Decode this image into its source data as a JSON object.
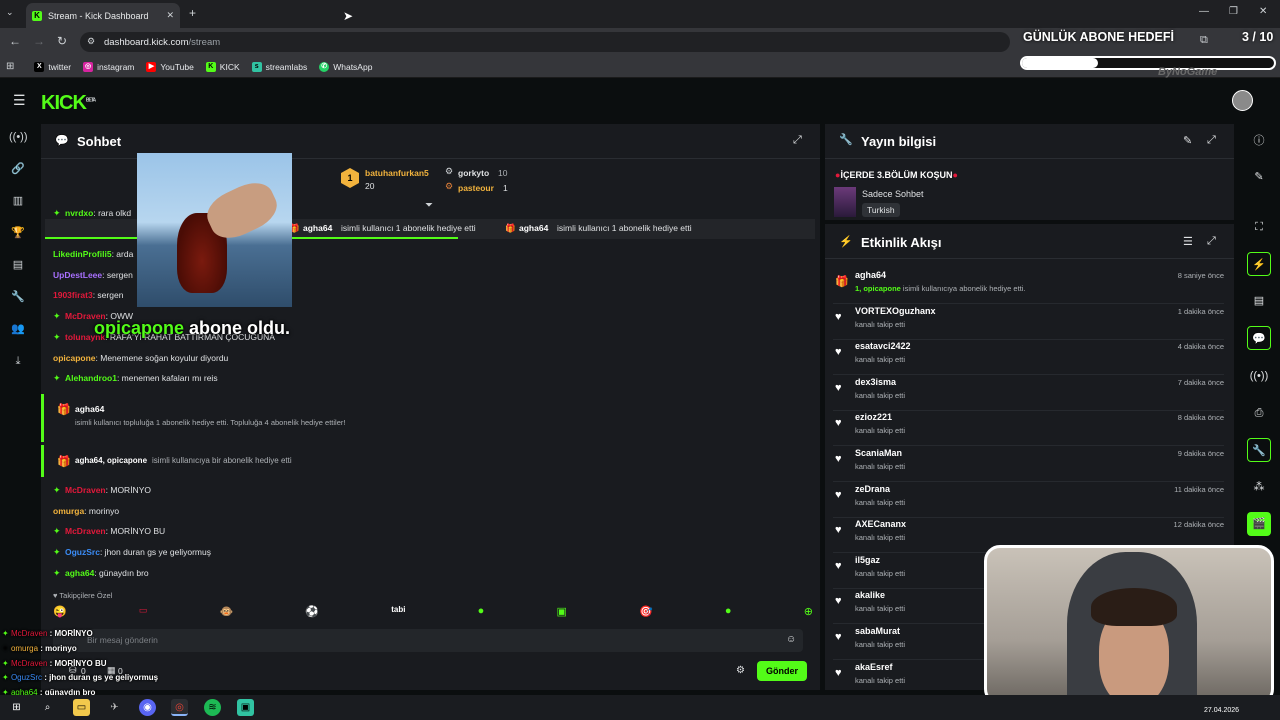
{
  "browser": {
    "tab_title": "Stream - Kick Dashboard",
    "tab_favicon": "kick-logo-icon",
    "new_tab_icon": "+",
    "url_domain": "dashboard.kick.com",
    "url_path": "/stream",
    "bookmarks": [
      {
        "label": "twitter",
        "icon": "x-logo-icon",
        "color": "#000000"
      },
      {
        "label": "instagram",
        "icon": "instagram-icon",
        "color": "#d6249f"
      },
      {
        "label": "YouTube",
        "icon": "youtube-icon",
        "color": "#ff0000"
      },
      {
        "label": "KICK",
        "icon": "kick-logo-icon",
        "color": "#53fc18"
      },
      {
        "label": "streamlabs",
        "icon": "streamlabs-icon",
        "color": "#31c3a2"
      },
      {
        "label": "WhatsApp",
        "icon": "whatsapp-icon",
        "color": "#25d366"
      }
    ]
  },
  "overlay": {
    "goal_title": "GÜNLÜK ABONE HEDEFİ",
    "goal_count": "3 / 10",
    "goal_progress": 0.3,
    "brand": "ByNoGame",
    "sub_alert": "opicapone abone oldu.",
    "sub_alert_user": "opicapone"
  },
  "colors": {
    "accent": "#53fc18",
    "panel": "#191b1f",
    "bg": "#0b0e0f",
    "red_user": "#e3193b",
    "purple_user": "#a970ff",
    "gold_user": "#f2b33d",
    "blue_user": "#3b8cf6",
    "green_user": "#53fc18"
  },
  "chat": {
    "title": "Sohbet",
    "pinned_ticker": "isimli kullanıcı 1 abonelik hediye etti",
    "ticker_user": "agha64",
    "leaderboard": [
      {
        "rank": "1",
        "name": "batuhanfurkan5",
        "count": "20"
      },
      {
        "name": "gorkyto",
        "count": "10"
      },
      {
        "name": "pasteour",
        "count": "1"
      }
    ],
    "messages": [
      {
        "user": "nvrdxo",
        "text": ": rara olkd",
        "color": "#53fc18",
        "badge": true
      },
      {
        "user": "LikedinProfili5",
        "text": ": arda",
        "color": "#53fc18"
      },
      {
        "user": "UpDestLeee",
        "text": ": sergen",
        "color": "#a970ff"
      },
      {
        "user": "1903firat3",
        "text": ": sergen",
        "color": "#e3193b"
      },
      {
        "user": "McDraven",
        "text": ": OWW",
        "color": "#e3193b",
        "badge": true
      },
      {
        "user": "tolunaynk",
        "text": ": RAFA'YI RAHAT BATTIRMAN ÇOCUĞUNA",
        "color": "#e3193b",
        "badge": true
      },
      {
        "user": "opicapone",
        "text": ": Menemene soğan koyulur diyordu",
        "color": "#f2b33d"
      },
      {
        "user": "Alehandroo1",
        "text": ": menemen kafaları mı reis",
        "color": "#53fc18",
        "badge": true
      }
    ],
    "gift1_user": "agha64",
    "gift1_text": "isimli kullanıcı topluluğa 1 abonelik hediye etti. Topluluğa 4 abonelik hediye ettiler!",
    "gift2_user": "agha64, opicapone",
    "gift2_text": " isimli kullanıcıya bir abonelik hediye etti",
    "messages2": [
      {
        "user": "McDraven",
        "text": ": MORİNYO",
        "color": "#e3193b",
        "badge": true
      },
      {
        "user": "omurga",
        "text": ": morinyo",
        "color": "#f2b33d"
      },
      {
        "user": "McDraven",
        "text": ": MORİNYO BU",
        "color": "#e3193b",
        "badge": true
      },
      {
        "user": "OguzSrc",
        "text": ": jhon duran gs ye geliyormuş",
        "color": "#3b8cf6",
        "badge": true
      },
      {
        "user": "agha64",
        "text": ": günaydın bro",
        "color": "#53fc18",
        "badge": true
      }
    ],
    "followers_only": "Takipçilere Özel",
    "input_placeholder": "Bir mesaj gönderin",
    "send_label": "Gönder",
    "counter_a": "0",
    "counter_b": "0"
  },
  "overlay_chat": [
    {
      "user": "McDraven",
      "text": " : MORİNYO",
      "color": "#e3193b"
    },
    {
      "user": "omurga",
      "text": " : morinyo",
      "color": "#f2b33d"
    },
    {
      "user": "McDraven",
      "text": " : MORİNYO BU",
      "color": "#e3193b"
    },
    {
      "user": "OguzSrc",
      "text": " : jhon duran gs ye geliyormuş",
      "color": "#3b8cf6"
    },
    {
      "user": "agha64",
      "text": " : günaydın bro",
      "color": "#53fc18"
    }
  ],
  "stream_info": {
    "title": "Yayın bilgisi",
    "stream_title": "İÇERDE 3.BÖLÜM KOŞUN",
    "category": "Sadece Sohbet",
    "language": "Turkish"
  },
  "feed": {
    "title": "Etkinlik Akışı",
    "items": [
      {
        "name": "agha64",
        "sub_user": "1, opicapone",
        "sub": " isimli kullanıcıya abonelik hediye etti.",
        "time": "8 saniye önce",
        "icon": "gift-icon"
      },
      {
        "name": "VORTEXOguzhanx",
        "sub": "kanalı takip etti",
        "time": "1 dakika önce",
        "icon": "heart-icon"
      },
      {
        "name": "esatavci2422",
        "sub": "kanalı takip etti",
        "time": "4 dakika önce",
        "icon": "heart-icon"
      },
      {
        "name": "dex3isma",
        "sub": "kanalı takip etti",
        "time": "7 dakika önce",
        "icon": "heart-icon"
      },
      {
        "name": "ezioz221",
        "sub": "kanalı takip etti",
        "time": "8 dakika önce",
        "icon": "heart-icon"
      },
      {
        "name": "ScaniaMan",
        "sub": "kanalı takip etti",
        "time": "9 dakika önce",
        "icon": "heart-icon"
      },
      {
        "name": "zeDrana",
        "sub": "kanalı takip etti",
        "time": "11 dakika önce",
        "icon": "heart-icon"
      },
      {
        "name": "AXECananx",
        "sub": "kanalı takip etti",
        "time": "12 dakika önce",
        "icon": "heart-icon"
      },
      {
        "name": "il5gaz",
        "sub": "kanalı takip etti",
        "time": "",
        "icon": "heart-icon"
      },
      {
        "name": "akalike",
        "sub": "kanalı takip etti",
        "time": "",
        "icon": "heart-icon"
      },
      {
        "name": "sabaMurat",
        "sub": "kanalı takip etti",
        "time": "",
        "icon": "heart-icon"
      },
      {
        "name": "akaEsref",
        "sub": "kanalı takip etti",
        "time": "",
        "icon": "heart-icon"
      }
    ]
  },
  "taskbar": {
    "date": "27.04.2026"
  }
}
